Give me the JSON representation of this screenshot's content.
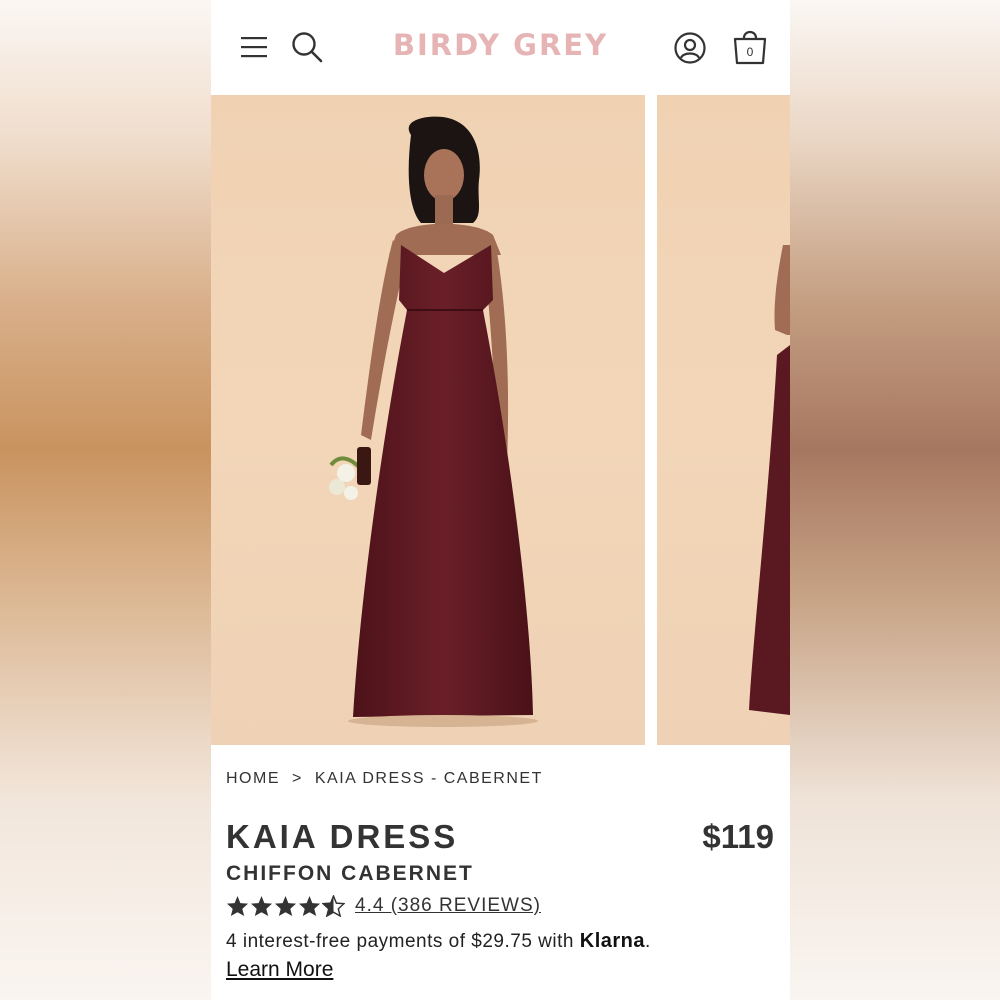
{
  "header": {
    "logo": "BIRDY GREY",
    "cart_count": "0"
  },
  "breadcrumb": {
    "home": "HOME",
    "separator": ">",
    "current": "KAIA DRESS - CABERNET"
  },
  "product": {
    "name": "KAIA DRESS",
    "price": "$119",
    "color": "CHIFFON CABERNET",
    "rating": 4.4,
    "rating_text": "4.4 (386 REVIEWS)",
    "payment_prefix": "4 interest-free payments of $29.75 with",
    "payment_provider": "Klarna",
    "payment_suffix": ".",
    "learn_more": "Learn More"
  },
  "colors": {
    "brand": "#e6b4b4",
    "dress": "#5e1a22",
    "text": "#333333"
  },
  "icons": [
    "menu-icon",
    "search-icon",
    "account-icon",
    "cart-icon",
    "star-icon"
  ]
}
